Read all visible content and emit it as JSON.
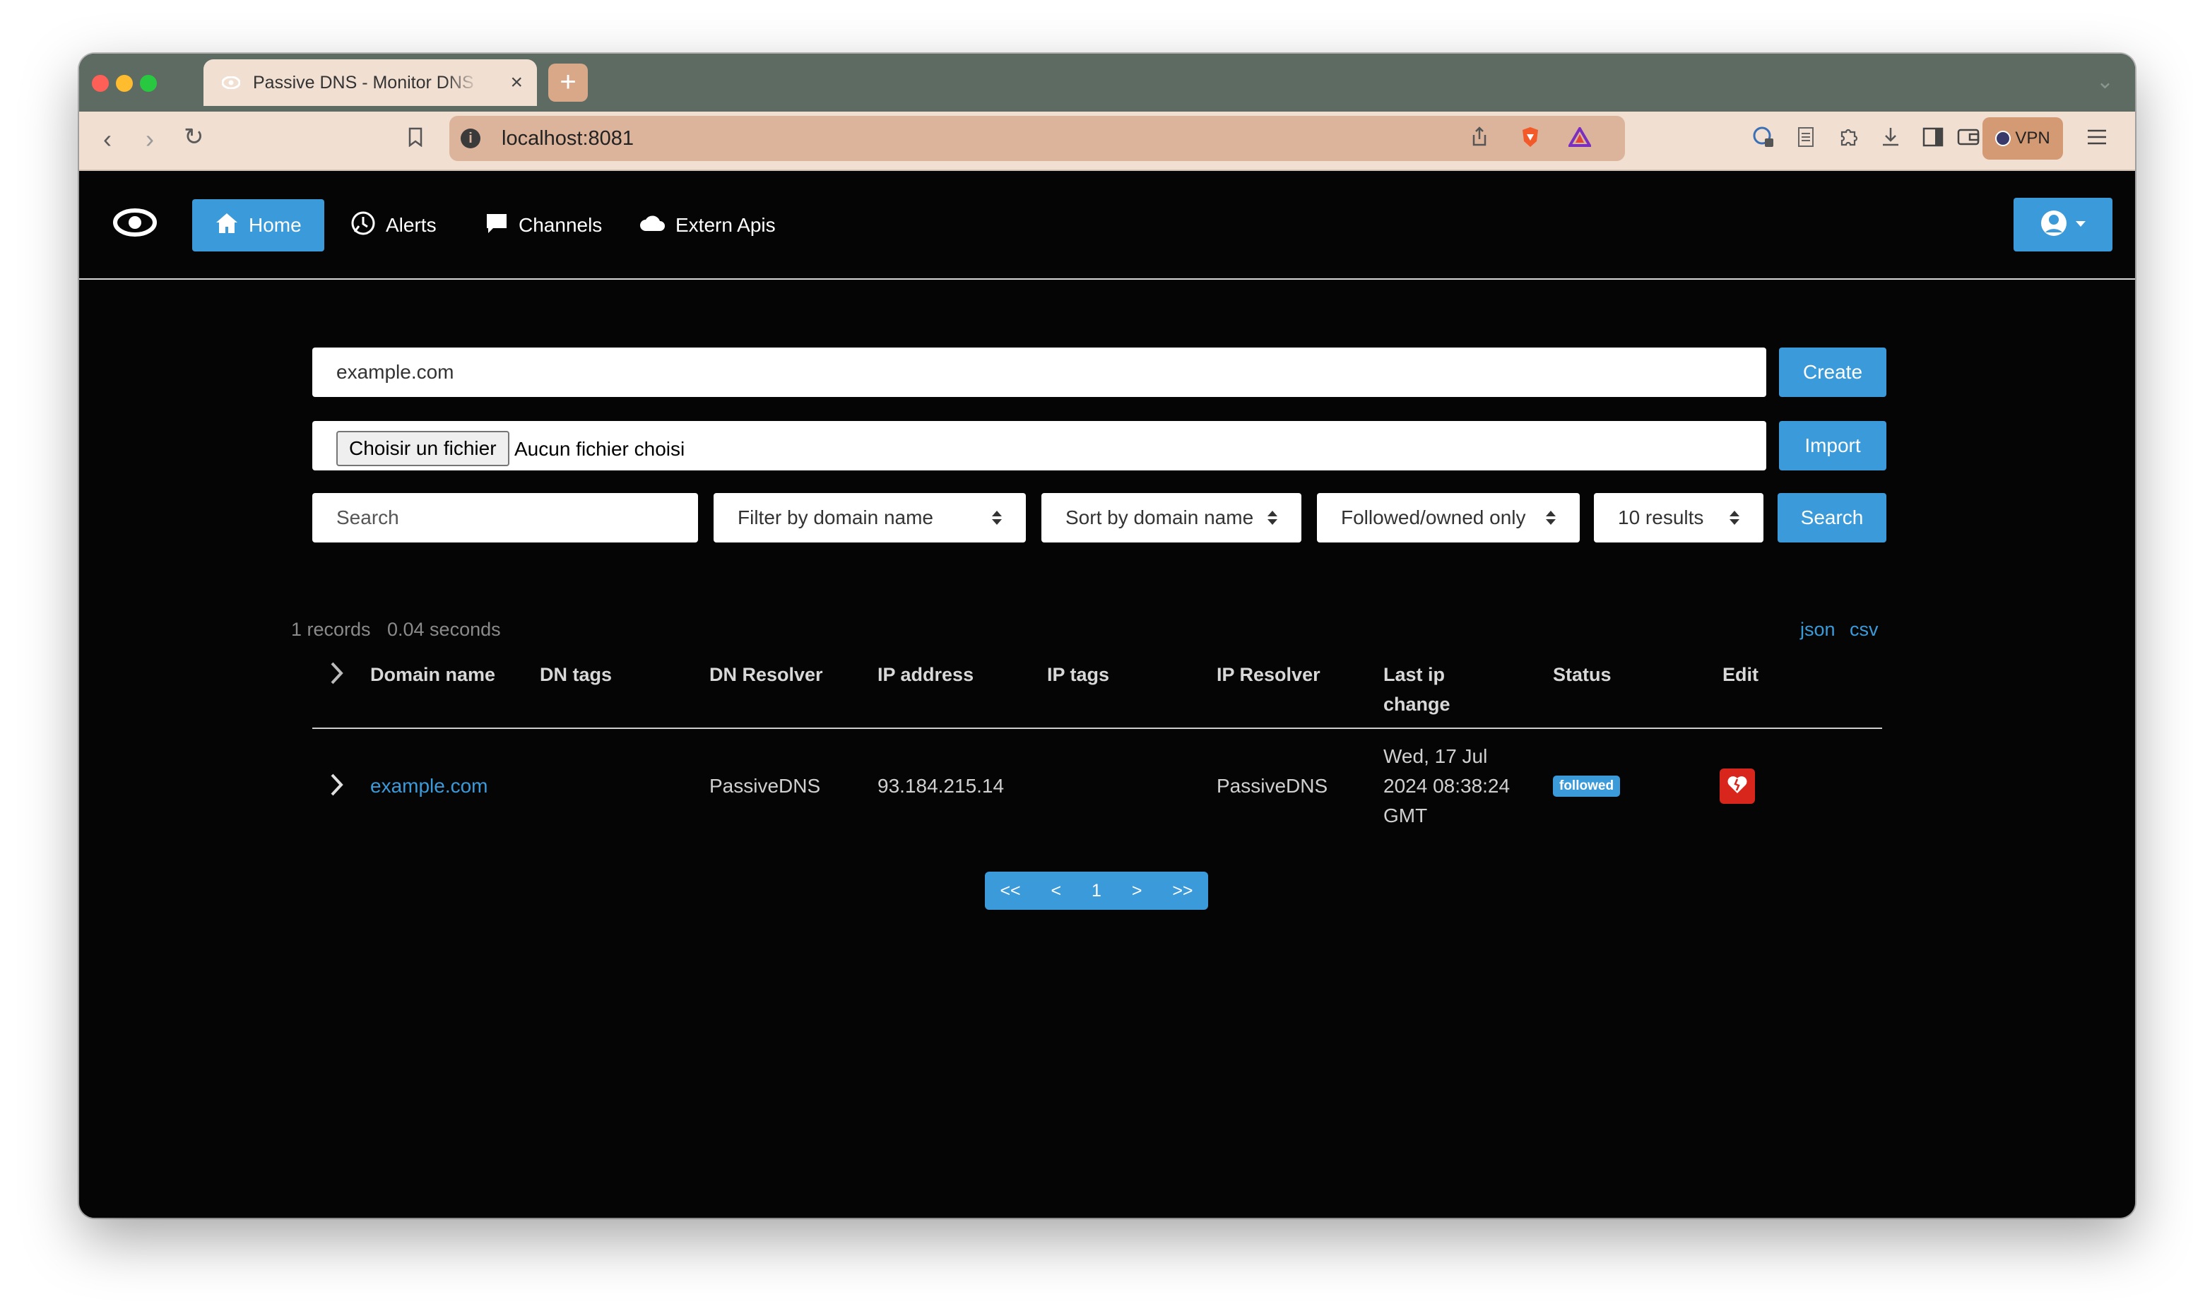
{
  "browser": {
    "tab_title": "Passive DNS - Monitor DNS records",
    "url": "localhost:8081",
    "vpn_label": "VPN",
    "colors": {
      "tabstrip": "#5d6b63",
      "toolbar": "#f1dfd2",
      "urlbar": "#dcb49b"
    }
  },
  "nav": {
    "items": [
      {
        "label": "Home",
        "icon": "home-icon",
        "active": true
      },
      {
        "label": "Alerts",
        "icon": "alert-clock-icon",
        "active": false
      },
      {
        "label": "Channels",
        "icon": "chat-icon",
        "active": false
      },
      {
        "label": "Extern Apis",
        "icon": "cloud-icon",
        "active": false
      }
    ],
    "user_icon": "user-circle-icon"
  },
  "create": {
    "value": "example.com",
    "button": "Create"
  },
  "import": {
    "file_button": "Choisir un fichier",
    "file_status": "Aucun fichier choisi",
    "button": "Import"
  },
  "search": {
    "placeholder": "Search",
    "filter": "Filter by domain name",
    "sort": "Sort by domain name",
    "scope": "Followed/owned only",
    "limit": "10 results",
    "button": "Search"
  },
  "results": {
    "count": "1 records",
    "time": "0.04 seconds",
    "export_json": "json",
    "export_csv": "csv"
  },
  "table": {
    "headers": [
      "Domain name",
      "DN tags",
      "DN Resolver",
      "IP address",
      "IP tags",
      "IP Resolver",
      "Last ip",
      "change",
      "Status",
      "Edit"
    ],
    "rows": [
      {
        "domain": "example.com",
        "dn_tags": "",
        "dn_resolver": "PassiveDNS",
        "ip": "93.184.215.14",
        "ip_tags": "",
        "ip_resolver": "PassiveDNS",
        "last_change_1": "Wed, 17 Jul",
        "last_change_2": "2024 08:38:24",
        "last_change_3": "GMT",
        "status": "followed"
      }
    ]
  },
  "pagination": {
    "first": "<<",
    "prev": "<",
    "page": "1",
    "next": ">",
    "last": ">>"
  },
  "colors": {
    "accent": "#3b9ad9",
    "danger": "#d9261c",
    "background": "#050505"
  }
}
